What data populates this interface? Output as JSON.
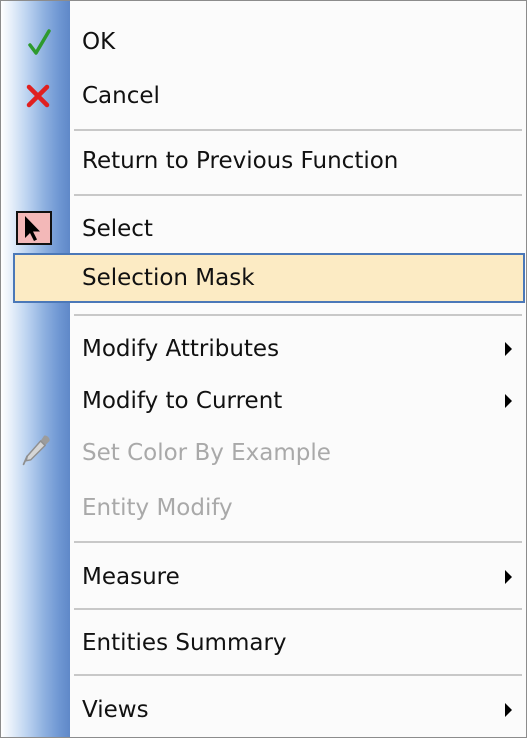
{
  "menu": {
    "items": [
      {
        "label": "OK",
        "icon": "checkmark-icon"
      },
      {
        "label": "Cancel",
        "icon": "cross-icon"
      },
      {
        "label": "Return to Previous Function"
      },
      {
        "label": "Select",
        "icon": "select-arrow-icon"
      },
      {
        "label": "Selection Mask",
        "highlighted": true
      },
      {
        "label": "Modify Attributes",
        "submenu": true
      },
      {
        "label": "Modify to Current",
        "submenu": true
      },
      {
        "label": "Set Color By Example",
        "disabled": true,
        "icon": "eyedropper-icon"
      },
      {
        "label": "Entity Modify",
        "disabled": true
      },
      {
        "label": "Measure",
        "submenu": true
      },
      {
        "label": "Entities Summary"
      },
      {
        "label": "Views",
        "submenu": true
      }
    ]
  },
  "colors": {
    "highlight_fill": "#fcebc4",
    "highlight_border": "#4b78b8",
    "check_green": "#2e9a2e",
    "cancel_red": "#e02020",
    "disabled_text": "#a9a9a9"
  }
}
